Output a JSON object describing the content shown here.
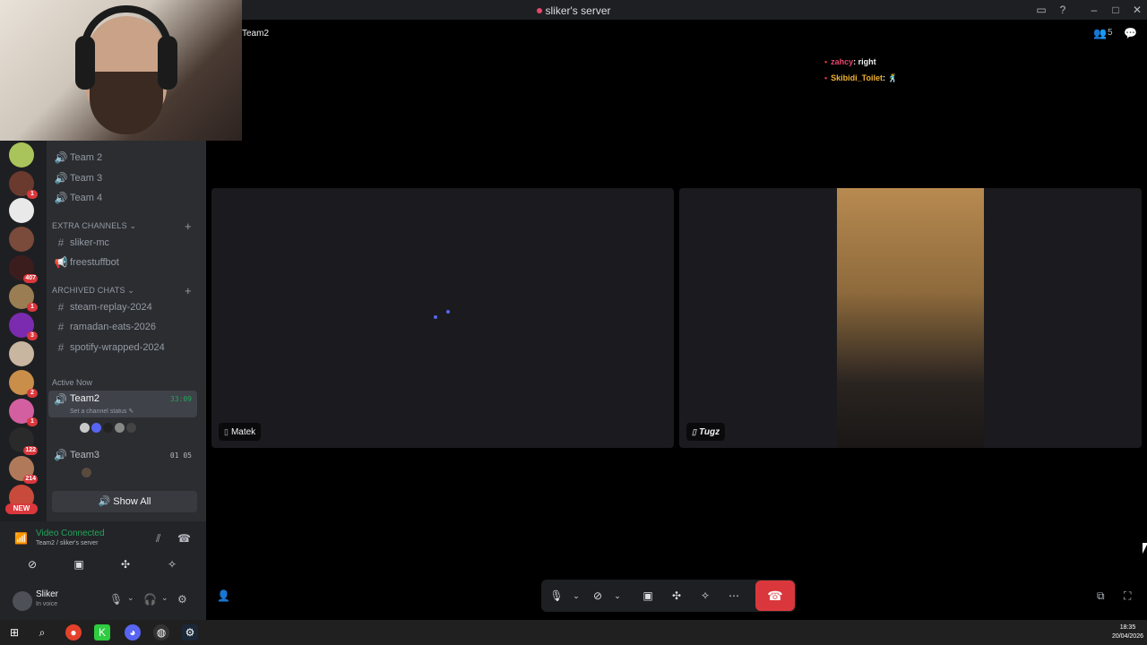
{
  "window": {
    "title": "sliker's server"
  },
  "channels": {
    "voice": [
      {
        "label": "Team 2"
      },
      {
        "label": "Team 3"
      },
      {
        "label": "Team 4"
      }
    ],
    "extra_category": "EXTRA CHANNELS",
    "extra": [
      {
        "label": "sliker-mc",
        "icon": "#"
      },
      {
        "label": "freestuffbot",
        "icon": "megaphone"
      }
    ],
    "archived_category": "ARCHIVED CHATS",
    "archived": [
      {
        "label": "steam-replay-2024"
      },
      {
        "label": "ramadan-eats-2026"
      },
      {
        "label": "spotify-wrapped-2024"
      }
    ],
    "active_now_label": "Active Now",
    "active": [
      {
        "label": "Team2",
        "time": "33:09",
        "status": "Set a channel status"
      },
      {
        "label": "Team3",
        "time": "01 05"
      }
    ],
    "show_all": "Show All"
  },
  "servers": {
    "badges": [
      "1",
      "407",
      "1",
      "3",
      "2",
      "1",
      "122",
      "214"
    ],
    "new_label": "NEW"
  },
  "voice_panel": {
    "title": "Video Connected",
    "subtitle": "Team2 / sliker's server"
  },
  "user": {
    "name": "Sliker",
    "status": "In voice"
  },
  "header": {
    "channel": "Team2",
    "member_count": "5"
  },
  "chat": [
    {
      "user": "zahcy",
      "text": ": right"
    },
    {
      "user": "Skibidi_Toilet",
      "text": ": 🕺"
    }
  ],
  "tiles": [
    {
      "name": "Matek"
    },
    {
      "name": "Tugz"
    }
  ],
  "clock": {
    "time": "18:35",
    "date": "20/04/2026"
  },
  "colors": {
    "accent": "#5865f2",
    "danger": "#da373c",
    "online": "#23a55a"
  }
}
